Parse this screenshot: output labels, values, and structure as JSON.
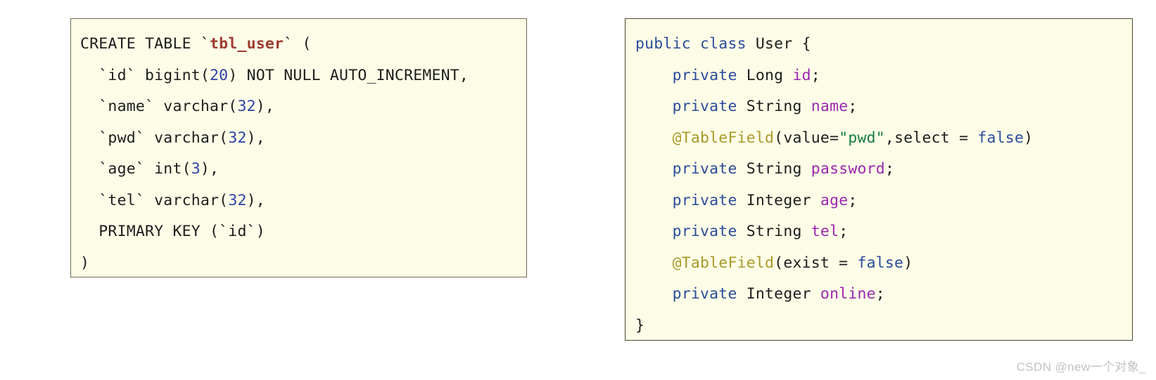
{
  "colors": {
    "page_background": "#ffffff",
    "code_background": "#fdfde7",
    "sql_border": "#6d6d55",
    "java_border": "#4a4a34",
    "plain_text": "#1d1d1d",
    "number_literal": "#2d41a8",
    "table_name": "#9e3b31",
    "keyword": "#2b4c9b",
    "field_name": "#9c27b0",
    "annotation": "#a89a28",
    "string_literal": "#167d42",
    "watermark": "#c2c2c2"
  },
  "sql_panel": {
    "language": "sql",
    "lines": [
      [
        {
          "text": "CREATE TABLE ",
          "token": "plain"
        },
        {
          "text": "`",
          "token": "plain"
        },
        {
          "text": "tbl_user",
          "token": "table"
        },
        {
          "text": "`",
          "token": "plain"
        },
        {
          "text": " (",
          "token": "plain"
        }
      ],
      [
        {
          "text": "  `id` bigint(",
          "token": "plain"
        },
        {
          "text": "20",
          "token": "number"
        },
        {
          "text": ") NOT NULL AUTO_INCREMENT,",
          "token": "plain"
        }
      ],
      [
        {
          "text": "  `name` varchar(",
          "token": "plain"
        },
        {
          "text": "32",
          "token": "number"
        },
        {
          "text": "),",
          "token": "plain"
        }
      ],
      [
        {
          "text": "  `pwd` varchar(",
          "token": "plain"
        },
        {
          "text": "32",
          "token": "number"
        },
        {
          "text": "),",
          "token": "plain"
        }
      ],
      [
        {
          "text": "  `age` int(",
          "token": "plain"
        },
        {
          "text": "3",
          "token": "number"
        },
        {
          "text": "),",
          "token": "plain"
        }
      ],
      [
        {
          "text": "  `tel` varchar(",
          "token": "plain"
        },
        {
          "text": "32",
          "token": "number"
        },
        {
          "text": "),",
          "token": "plain"
        }
      ],
      [
        {
          "text": "  PRIMARY KEY (`id`)",
          "token": "plain"
        }
      ],
      [
        {
          "text": ")",
          "token": "plain"
        }
      ]
    ],
    "plain_text": "CREATE TABLE `tbl_user` (\n  `id` bigint(20) NOT NULL AUTO_INCREMENT,\n  `name` varchar(32),\n  `pwd` varchar(32),\n  `age` int(3),\n  `tel` varchar(32),\n  PRIMARY KEY (`id`)\n)"
  },
  "java_panel": {
    "language": "java",
    "lines": [
      [
        {
          "text": "public class",
          "token": "keyword"
        },
        {
          "text": " ",
          "token": "plain"
        },
        {
          "text": "User",
          "token": "type"
        },
        {
          "text": " {",
          "token": "plain"
        }
      ],
      [
        {
          "text": "    ",
          "token": "plain"
        },
        {
          "text": "private",
          "token": "keyword"
        },
        {
          "text": " ",
          "token": "plain"
        },
        {
          "text": "Long",
          "token": "type"
        },
        {
          "text": " ",
          "token": "plain"
        },
        {
          "text": "id",
          "token": "field"
        },
        {
          "text": ";",
          "token": "plain"
        }
      ],
      [
        {
          "text": "    ",
          "token": "plain"
        },
        {
          "text": "private",
          "token": "keyword"
        },
        {
          "text": " ",
          "token": "plain"
        },
        {
          "text": "String",
          "token": "type"
        },
        {
          "text": " ",
          "token": "plain"
        },
        {
          "text": "name",
          "token": "field"
        },
        {
          "text": ";",
          "token": "plain"
        }
      ],
      [
        {
          "text": "    ",
          "token": "plain"
        },
        {
          "text": "@TableField",
          "token": "annot"
        },
        {
          "text": "(value=",
          "token": "plain"
        },
        {
          "text": "\"pwd\"",
          "token": "string"
        },
        {
          "text": ",select = ",
          "token": "plain"
        },
        {
          "text": "false",
          "token": "keyword"
        },
        {
          "text": ")",
          "token": "plain"
        }
      ],
      [
        {
          "text": "    ",
          "token": "plain"
        },
        {
          "text": "private",
          "token": "keyword"
        },
        {
          "text": " ",
          "token": "plain"
        },
        {
          "text": "String",
          "token": "type"
        },
        {
          "text": " ",
          "token": "plain"
        },
        {
          "text": "password",
          "token": "field"
        },
        {
          "text": ";",
          "token": "plain"
        }
      ],
      [
        {
          "text": "    ",
          "token": "plain"
        },
        {
          "text": "private",
          "token": "keyword"
        },
        {
          "text": " ",
          "token": "plain"
        },
        {
          "text": "Integer",
          "token": "type"
        },
        {
          "text": " ",
          "token": "plain"
        },
        {
          "text": "age",
          "token": "field"
        },
        {
          "text": ";",
          "token": "plain"
        }
      ],
      [
        {
          "text": "    ",
          "token": "plain"
        },
        {
          "text": "private",
          "token": "keyword"
        },
        {
          "text": " ",
          "token": "plain"
        },
        {
          "text": "String",
          "token": "type"
        },
        {
          "text": " ",
          "token": "plain"
        },
        {
          "text": "tel",
          "token": "field"
        },
        {
          "text": ";",
          "token": "plain"
        }
      ],
      [
        {
          "text": "    ",
          "token": "plain"
        },
        {
          "text": "@TableField",
          "token": "annot"
        },
        {
          "text": "(exist = ",
          "token": "plain"
        },
        {
          "text": "false",
          "token": "keyword"
        },
        {
          "text": ")",
          "token": "plain"
        }
      ],
      [
        {
          "text": "    ",
          "token": "plain"
        },
        {
          "text": "private",
          "token": "keyword"
        },
        {
          "text": " ",
          "token": "plain"
        },
        {
          "text": "Integer",
          "token": "type"
        },
        {
          "text": " ",
          "token": "plain"
        },
        {
          "text": "online",
          "token": "field"
        },
        {
          "text": ";",
          "token": "plain"
        }
      ],
      [
        {
          "text": "}",
          "token": "plain"
        }
      ]
    ],
    "plain_text": "public class User {\n    private Long id;\n    private String name;\n    @TableField(value=\"pwd\",select = false)\n    private String password;\n    private Integer age;\n    private String tel;\n    @TableField(exist = false)\n    private Integer online;\n}"
  },
  "watermark": {
    "text": "CSDN @new一个对象_"
  }
}
